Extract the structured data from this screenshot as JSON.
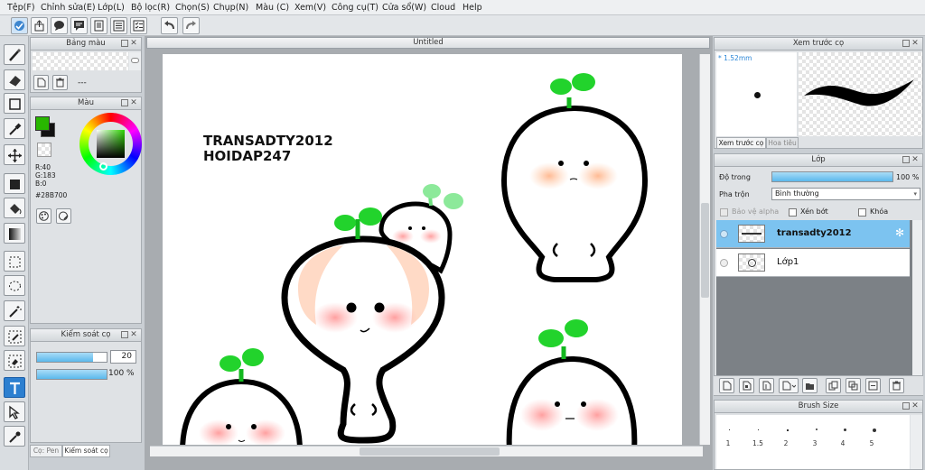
{
  "menu": [
    "Tệp(F)",
    "Chỉnh sửa(E)",
    "Lớp(L)",
    "Bộ lọc(R)",
    "Chọn(S)",
    "Chụp(N)",
    "Màu (C)",
    "Xem(V)",
    "Công cụ(T)",
    "Cửa sổ(W)",
    "Cloud",
    "Help"
  ],
  "swatch_panel": {
    "title": "Bảng màu",
    "dash": "---"
  },
  "color_panel": {
    "title": "Màu",
    "r": "R:40",
    "g": "G:183",
    "b": "B:0",
    "hex": "#28B700",
    "main_color": "#28B700"
  },
  "brush_control": {
    "title": "Kiểm soát cọ",
    "size_value": "20",
    "size_fraction": 0.8,
    "opacity_label": "100 %",
    "opacity_fraction": 1.0
  },
  "bottom_tabs": [
    "Cọ: Pen",
    "Kiểm soát cọ"
  ],
  "document": {
    "tab_title": "Untitled"
  },
  "canvas_text": [
    "TRANSADTY2012",
    "HOIDAP247"
  ],
  "preview_panel": {
    "title": "Xem trước cọ",
    "size": "* 1.52mm",
    "tabs": [
      "Xem trước cọ",
      "Hoa tiêu"
    ]
  },
  "layer_panel": {
    "title": "Lớp",
    "opacity_label": "Độ trong",
    "opacity_value": "100 %",
    "opacity_fraction": 1.0,
    "blend_label": "Pha trộn",
    "blend_value": "Bình thường",
    "checks": [
      "Bảo vệ alpha",
      "Xén bớt",
      "Khóa"
    ],
    "layers": [
      "transadty2012",
      "Lớp1"
    ]
  },
  "brush_size_panel": {
    "title": "Brush Size",
    "sizes": [
      "1",
      "1.5",
      "2",
      "3",
      "4",
      "5"
    ]
  }
}
